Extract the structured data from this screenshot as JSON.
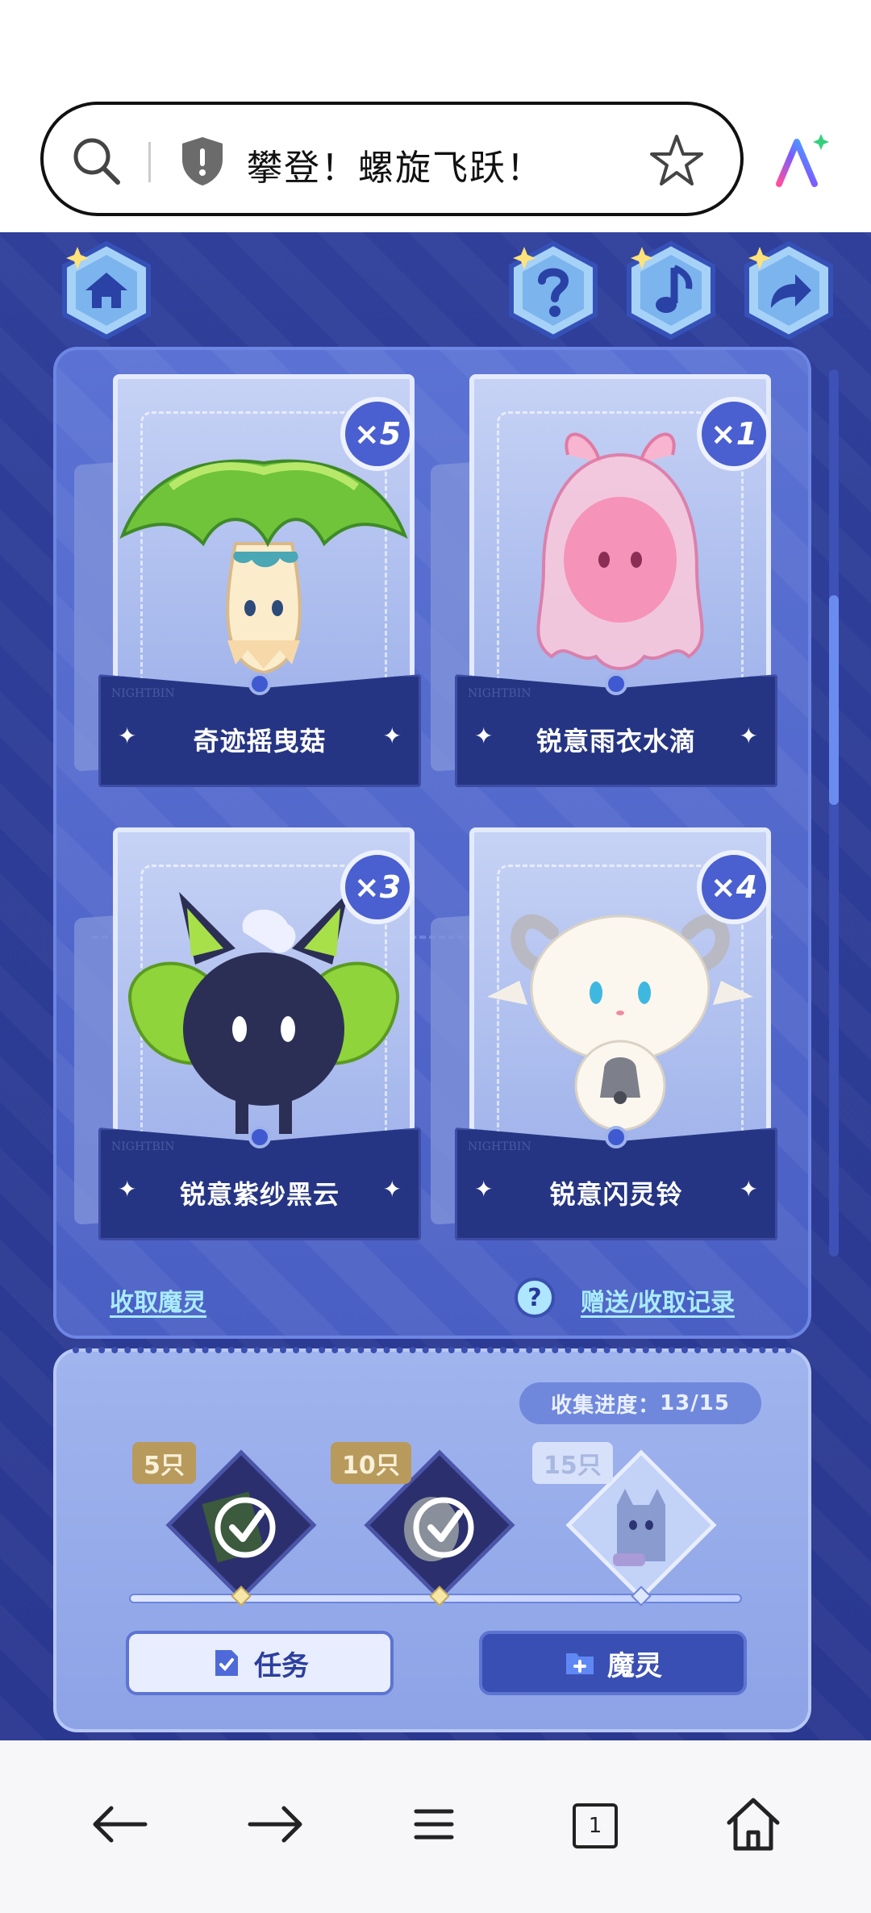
{
  "browser": {
    "page_title": "攀登！螺旋飞跃！",
    "tab_count": "1"
  },
  "cards": [
    {
      "name": "奇迹摇曳菇",
      "count": "×5",
      "watermark": "NIGHTBIN"
    },
    {
      "name": "锐意雨衣水滴",
      "count": "×1",
      "watermark": "NIGHTBIN"
    },
    {
      "name": "锐意紫纱黑云",
      "count": "×3",
      "watermark": "NIGHTBIN"
    },
    {
      "name": "锐意闪灵铃",
      "count": "×4",
      "watermark": "NIGHTBIN"
    }
  ],
  "links": {
    "collect": "收取魔灵",
    "records": "赠送/收取记录",
    "help": "?"
  },
  "progress": {
    "label": "收集进度：",
    "value": "13/15",
    "current": 13,
    "total": 15,
    "milestones": [
      {
        "tag": "5只",
        "claimed": true
      },
      {
        "tag": "10只",
        "claimed": true
      },
      {
        "tag": "15只",
        "claimed": false
      }
    ]
  },
  "buttons": {
    "task": "任务",
    "spirit": "魔灵"
  },
  "colors": {
    "accent": "#4a60d0",
    "background": "#2f3f9a",
    "link": "#a9ecff"
  }
}
